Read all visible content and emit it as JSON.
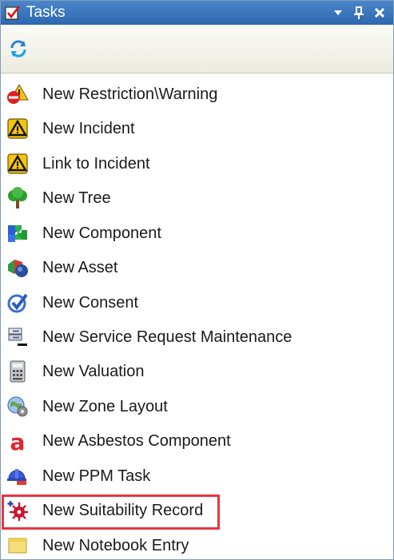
{
  "panel": {
    "title": "Tasks",
    "title_icon": "tasks-checkbox-icon",
    "dropdown_icon": "chevron-down-icon",
    "pin_icon": "pin-icon",
    "close_icon": "close-icon"
  },
  "toolbar": {
    "refresh_icon": "refresh-icon"
  },
  "tasks": [
    {
      "label": "New Restriction\\Warning",
      "icon": "restriction-warning-icon"
    },
    {
      "label": "New Incident",
      "icon": "incident-warning-icon"
    },
    {
      "label": "Link to Incident",
      "icon": "incident-warning-icon"
    },
    {
      "label": "New Tree",
      "icon": "tree-icon"
    },
    {
      "label": "New Component",
      "icon": "component-puzzle-icon"
    },
    {
      "label": "New Asset",
      "icon": "asset-icon"
    },
    {
      "label": "New Consent",
      "icon": "consent-check-icon"
    },
    {
      "label": "New Service Request Maintenance",
      "icon": "service-request-icon"
    },
    {
      "label": "New Valuation",
      "icon": "valuation-calculator-icon"
    },
    {
      "label": "New Zone Layout",
      "icon": "zone-layout-icon"
    },
    {
      "label": "New Asbestos Component",
      "icon": "asbestos-icon"
    },
    {
      "label": "New PPM Task",
      "icon": "ppm-hardhat-icon"
    },
    {
      "label": "New Suitability Record",
      "icon": "suitability-icon"
    },
    {
      "label": "New Notebook Entry",
      "icon": "notebook-icon"
    }
  ],
  "highlighted_task": "New Suitability Record",
  "colors": {
    "titlebar": "#3a77bd",
    "highlight": "#e8363f"
  }
}
